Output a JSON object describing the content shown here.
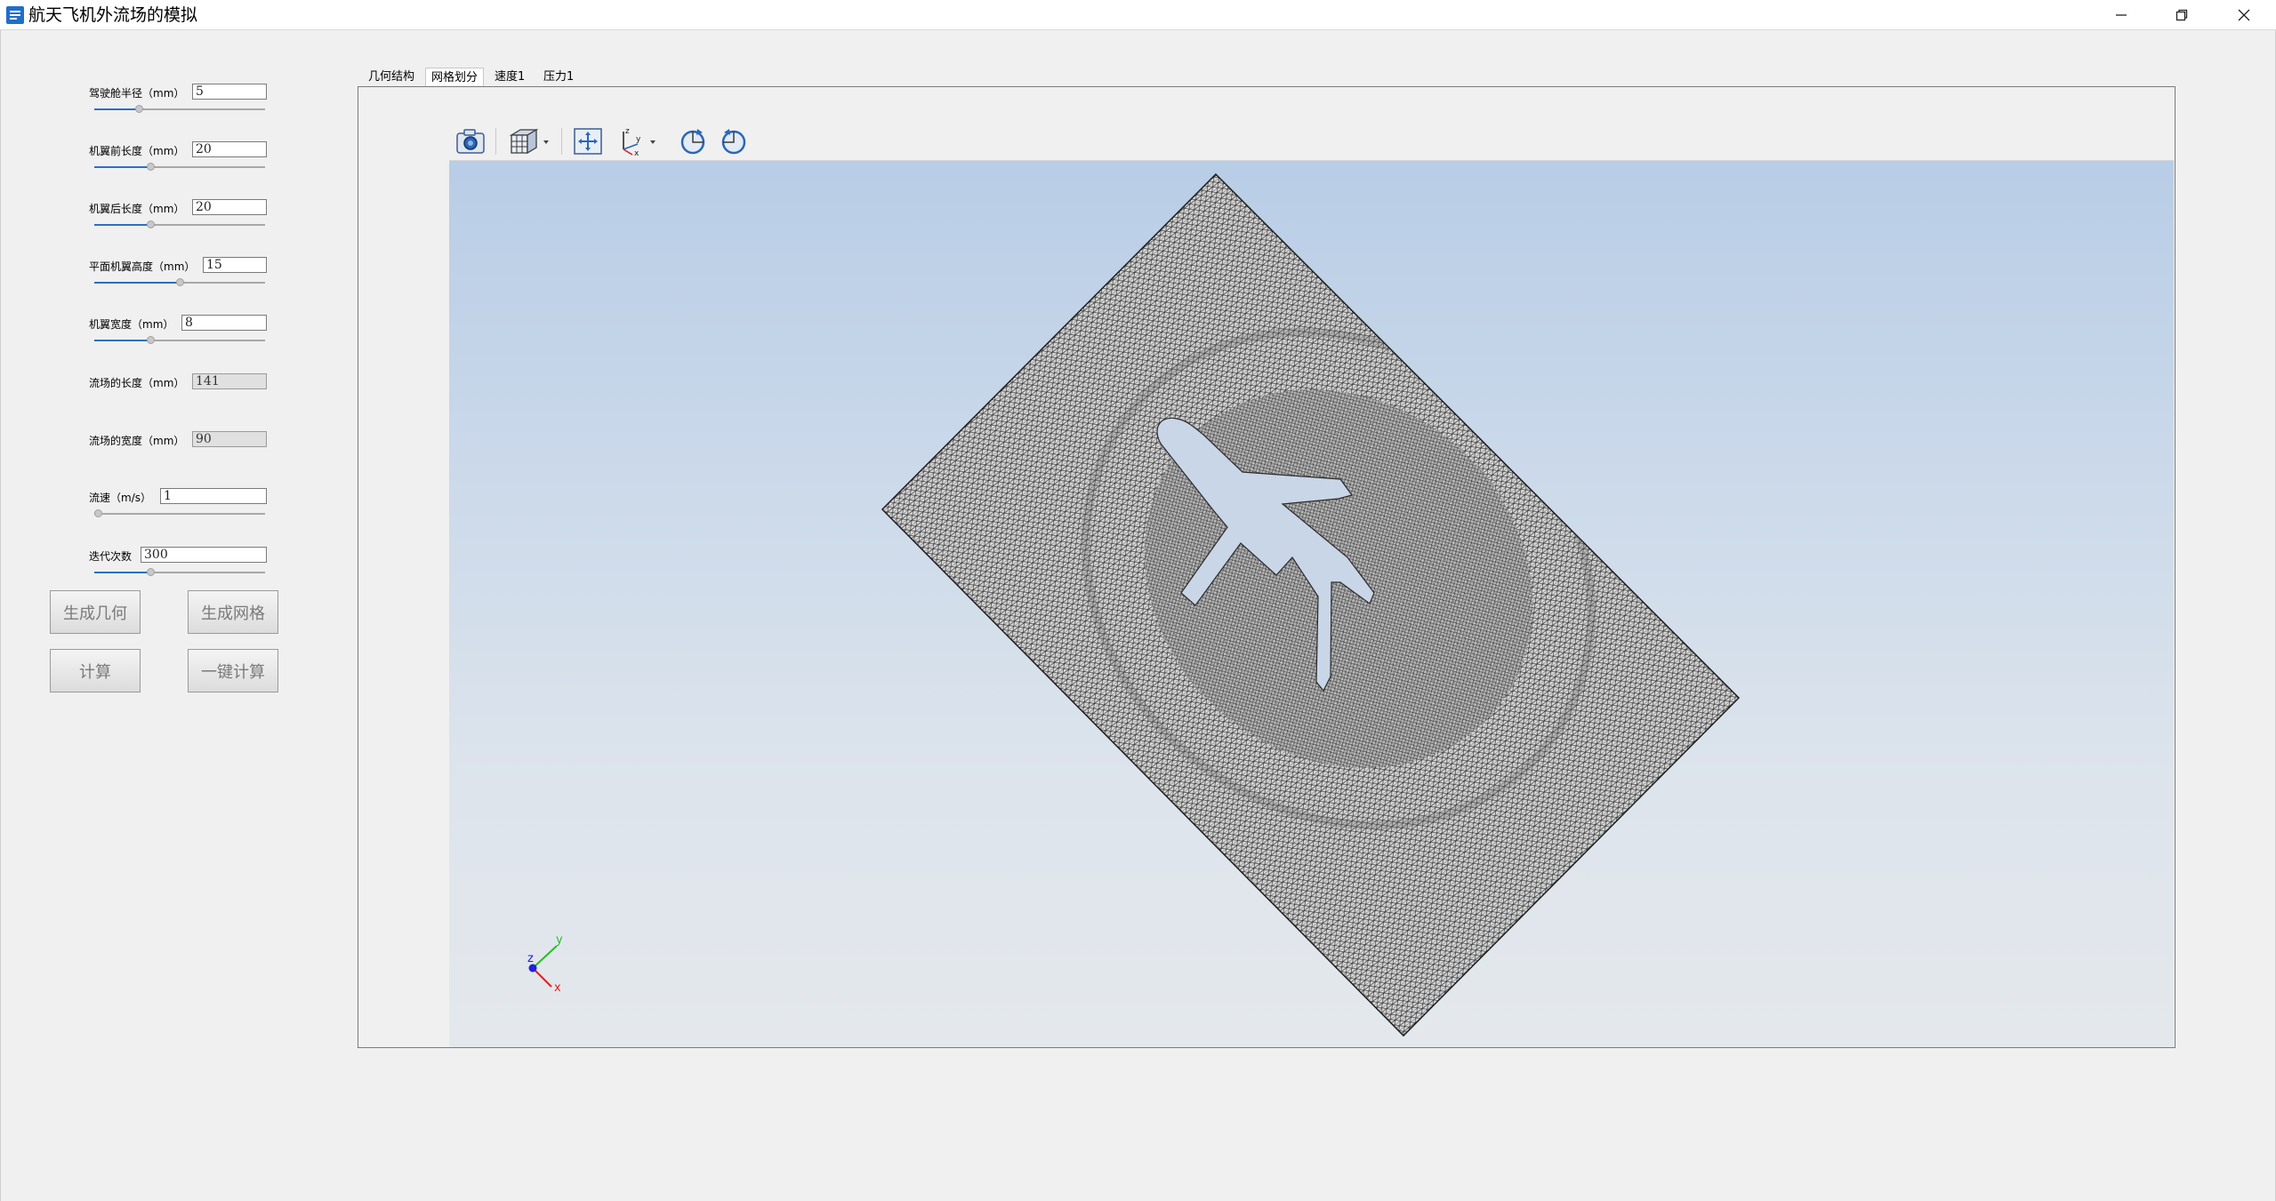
{
  "window": {
    "title": "航天飞机外流场的模拟"
  },
  "params": [
    {
      "label": "驾驶舱半径（mm）",
      "value": "5",
      "readonly": false,
      "slider": 0.25
    },
    {
      "label": "机翼前长度（mm）",
      "value": "20",
      "readonly": false,
      "slider": 0.32
    },
    {
      "label": "机翼后长度（mm）",
      "value": "20",
      "readonly": false,
      "slider": 0.32
    },
    {
      "label": "平面机翼高度（mm）",
      "value": "15",
      "readonly": false,
      "slider": 0.5
    },
    {
      "label": "机翼宽度（mm）",
      "value": "8",
      "readonly": false,
      "slider": 0.32
    },
    {
      "label": "流场的长度（mm）",
      "value": "141",
      "readonly": true
    },
    {
      "label": "流场的宽度（mm）",
      "value": "90",
      "readonly": true
    },
    {
      "label": "流速（m/s）",
      "value": "1",
      "readonly": false,
      "slider": 0.0
    },
    {
      "label": "迭代次数",
      "value": "300",
      "readonly": false,
      "slider": 0.32
    }
  ],
  "buttons": {
    "generate_geometry": "生成几何",
    "generate_mesh": "生成网格",
    "compute": "计算",
    "one_click_compute": "一键计算"
  },
  "tabs": [
    {
      "label": "几何结构",
      "active": false
    },
    {
      "label": "网格划分",
      "active": true
    },
    {
      "label": "速度1",
      "active": false
    },
    {
      "label": "压力1",
      "active": false
    }
  ],
  "toolbar": {
    "icons": [
      "camera-icon",
      "cube-view-icon",
      "fit-all-icon",
      "axes-orientation-icon",
      "rotate-cw-icon",
      "rotate-ccw-icon"
    ]
  },
  "triad": {
    "x_label": "x",
    "y_label": "y",
    "z_label": "z"
  },
  "colors": {
    "slider_fill": "#2d6fc2",
    "mesh_line": "#3a3a3a",
    "axis_x": "#e02020",
    "axis_y": "#20c020",
    "axis_z": "#2020e0"
  }
}
